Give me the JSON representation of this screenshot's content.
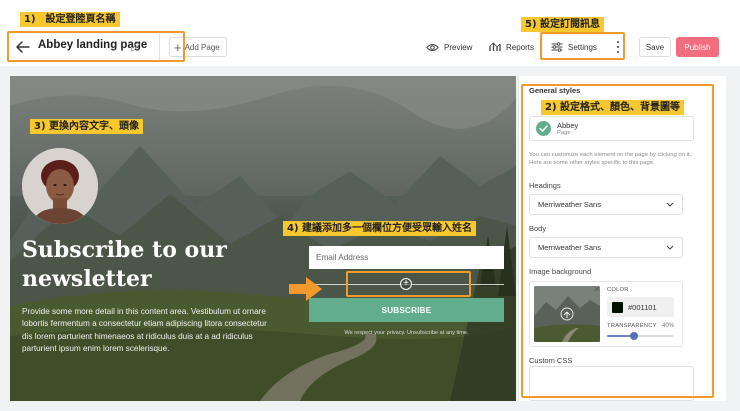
{
  "toolbar": {
    "page_name": "Abbey landing page",
    "add_page_label": "Add Page",
    "preview_label": "Preview",
    "reports_label": "Reports",
    "settings_label": "Settings",
    "save_label": "Save",
    "publish_label": "Publish",
    "icons": [
      "back-arrow-icon",
      "pencil-icon",
      "plus-icon",
      "eye-icon",
      "reports-icon",
      "sliders-icon",
      "kebab-menu-icon"
    ],
    "publish_color": "#f26d7d"
  },
  "landing_page": {
    "title": "Subscribe to our newsletter",
    "body": "Provide some more detail in this content area. Vestibulum ut ornare lobortis fermentum a consectetur etiam adipiscing litora consectetur dis lorem parturient himenaeos at ridiculus duis at a ad ridiculus parturient ipsum enim lorem scelerisque.",
    "email_placeholder": "Email Address",
    "subscribe_label": "SUBSCRIBE",
    "privacy_note": "We respect your privacy. Unsubscribe at any time.",
    "button_color": "#62ad8c"
  },
  "settings_panel": {
    "title": "General styles",
    "theme_name": "Abbey",
    "theme_type": "Page",
    "help_text": "You can customize each element on the page by clicking on it. Here are some other styles specific to this page.",
    "headings_label": "Headings",
    "headings_font": "Merriweather Sans",
    "body_label": "Body",
    "body_font": "Merriweather Sans",
    "image_bg_label": "Image background",
    "color_label": "COLOR",
    "color_value": "#001101",
    "transparency_label": "TRANSPARENCY",
    "transparency_value": "40%",
    "transparency_level": 0.4,
    "custom_css_label": "Custom CSS"
  },
  "annotations": {
    "a1": "1)　設定登陸頁名稱",
    "a2": "2) 設定格式、顏色、背景圖等",
    "a3": "3) 更換內容文字、頭像",
    "a4": "4) 建議添加多一個欄位方便受眾輸入姓名",
    "a5": "5) 設定訂閱訊息",
    "highlight_color": "#f29a2e",
    "tag_color": "#f7c82e"
  }
}
